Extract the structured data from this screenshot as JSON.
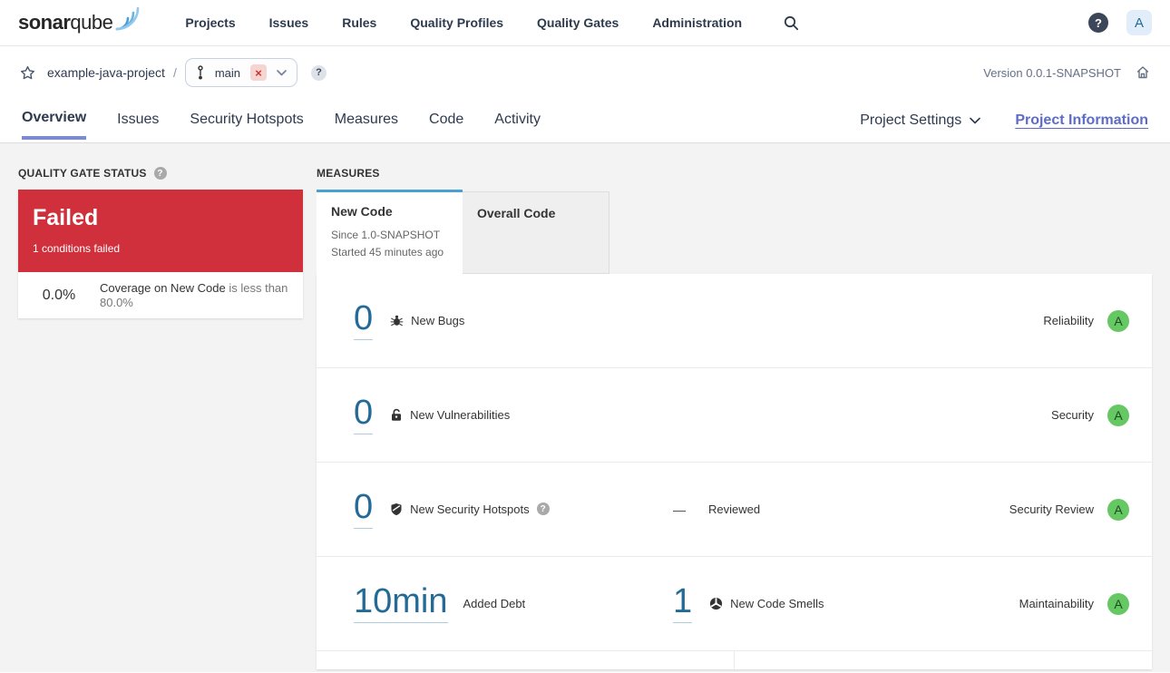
{
  "colors": {
    "accent_blue": "#4b9fd5",
    "link_blue": "#236a97",
    "failed_red": "#d0303c",
    "rating_a_green": "#65c863",
    "active_tab_underline": "#7b8ad1",
    "project_info_purple": "#5d6cc7"
  },
  "nav": {
    "logo_bold": "sonar",
    "logo_light": "qube",
    "items": [
      "Projects",
      "Issues",
      "Rules",
      "Quality Profiles",
      "Quality Gates",
      "Administration"
    ],
    "help_glyph": "?",
    "avatar_initial": "A"
  },
  "breadcrumb": {
    "project_name": "example-java-project",
    "separator": "/",
    "branch_name": "main",
    "close_glyph": "×",
    "help_glyph": "?",
    "version_label": "Version 0.0.1-SNAPSHOT"
  },
  "tabs": {
    "overview": "Overview",
    "issues": "Issues",
    "security_hotspots": "Security Hotspots",
    "measures": "Measures",
    "code": "Code",
    "activity": "Activity",
    "project_settings": "Project Settings",
    "project_information": "Project Information"
  },
  "quality_gate": {
    "section_title": "QUALITY GATE STATUS",
    "help_glyph": "?",
    "status": "Failed",
    "conditions_summary": "1 conditions failed",
    "condition_value": "0.0%",
    "condition_metric": "Coverage on New Code",
    "condition_comparison": " is less than ",
    "condition_threshold": "80.0%"
  },
  "measures": {
    "section_title": "MEASURES",
    "new_code_tab": {
      "label": "New Code",
      "since": "Since 1.0-SNAPSHOT",
      "started": "Started 45 minutes ago"
    },
    "overall_code_tab": {
      "label": "Overall Code"
    },
    "rows": {
      "bugs": {
        "value": "0",
        "label": "New Bugs",
        "rating_label": "Reliability",
        "rating": "A"
      },
      "vulnerabilities": {
        "value": "0",
        "label": "New Vulnerabilities",
        "rating_label": "Security",
        "rating": "A"
      },
      "hotspots": {
        "value": "0",
        "label": "New Security Hotspots",
        "help_glyph": "?",
        "reviewed_value": "—",
        "reviewed_label": "Reviewed",
        "rating_label": "Security Review",
        "rating": "A"
      },
      "maintainability": {
        "debt_value": "10min",
        "debt_label": "Added Debt",
        "smells_value": "1",
        "smells_label": "New Code Smells",
        "rating_label": "Maintainability",
        "rating": "A"
      }
    }
  }
}
